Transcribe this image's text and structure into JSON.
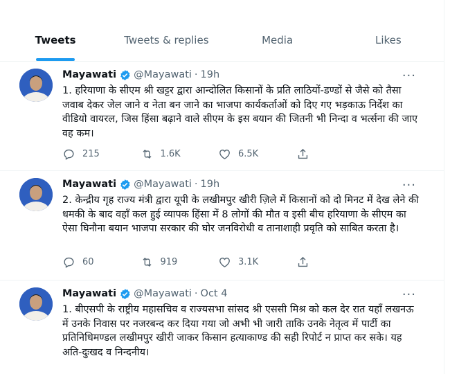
{
  "tabs": [
    {
      "label": "Tweets",
      "active": true
    },
    {
      "label": "Tweets & replies",
      "active": false
    },
    {
      "label": "Media",
      "active": false
    },
    {
      "label": "Likes",
      "active": false
    }
  ],
  "tweets": [
    {
      "name": "Mayawati",
      "handle": "@Mayawati",
      "dot": "·",
      "time": "19h",
      "text": "1. हरियाणा के सीएम श्री खट्टर द्वारा आन्दोलित किसानों के प्रति लाठियों-डण्डों से जैसे को तैसा जवाब देकर जेल जाने व नेता बन जाने का भाजपा कार्यकर्ताओं को दिए गए भड़काऊ निर्देश का वीडियो वायरल, जिस हिंसा बढ़ाने वाले सीएम के इस बयान की जितनी भी निन्दा व भर्त्सना की जाए वह कम।",
      "replies": "215",
      "retweets": "1.6K",
      "likes": "6.5K"
    },
    {
      "name": "Mayawati",
      "handle": "@Mayawati",
      "dot": "·",
      "time": "19h",
      "text": "2. केन्द्रीय गृह राज्य मंत्री द्वारा यूपी के लखीमपुर खीरी ज़िले में किसानों को दो मिनट में देख लेने की धमकी के बाद वहाँ कल हुई व्यापक हिंसा में 8 लोगों की मौत व इसी बीच हरियाणा के सीएम का ऐसा घिनौना बयान भाजपा सरकार की घोर जनविरोधी व तानाशाही प्रवृति को साबित करता है।",
      "replies": "60",
      "retweets": "919",
      "likes": "3.1K"
    },
    {
      "name": "Mayawati",
      "handle": "@Mayawati",
      "dot": "·",
      "time": "Oct 4",
      "text": "1. बीएसपी के राष्ट्रीय महासचिव व राज्यसभा सांसद श्री एससी मिश्र को कल देर रात यहाँ लखनऊ में उनके निवास पर नजरबन्द कर दिया गया जो अभी भी जारी ताकि उनके नेतृत्व में पार्टी का प्रतिनिधिमण्डल लखीमपुर खीरी जाकर किसान हत्याकाण्ड की सही रिपोर्ट न प्राप्त कर सके। यह अति-दुःखद व निन्दनीय।"
    }
  ],
  "more_glyph": "···",
  "colors": {
    "accent": "#1d9bf0",
    "text": "#0f1419",
    "muted": "#536471",
    "border": "#eff3f4"
  },
  "icons": [
    "verified-badge-icon",
    "reply-icon",
    "retweet-icon",
    "like-icon",
    "share-icon",
    "more-icon"
  ]
}
